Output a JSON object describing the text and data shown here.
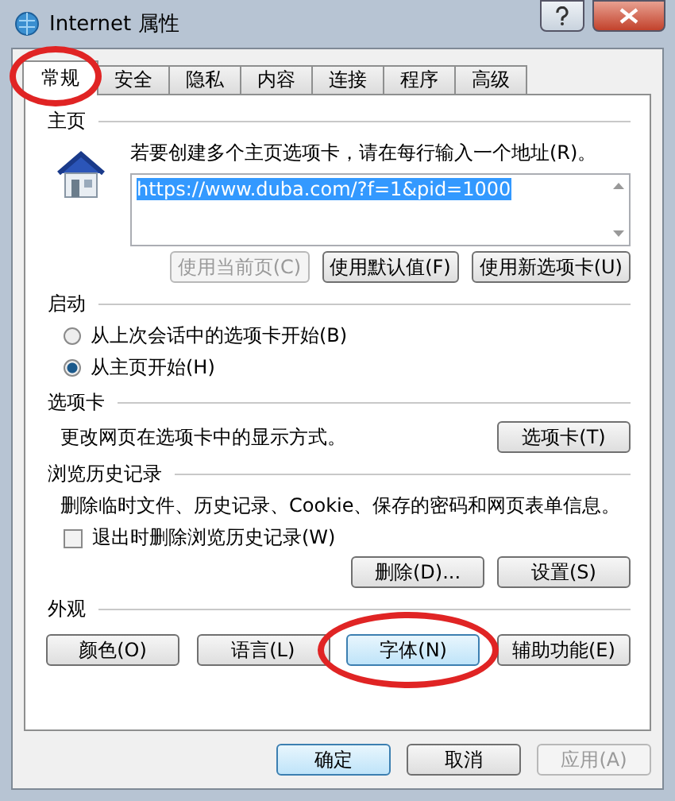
{
  "window": {
    "title": "Internet 属性"
  },
  "tabs": [
    {
      "label": "常规",
      "selected": true,
      "circled": true
    },
    {
      "label": "安全",
      "selected": false,
      "circled": false
    },
    {
      "label": "隐私",
      "selected": false,
      "circled": false
    },
    {
      "label": "内容",
      "selected": false,
      "circled": false
    },
    {
      "label": "连接",
      "selected": false,
      "circled": false
    },
    {
      "label": "程序",
      "selected": false,
      "circled": false
    },
    {
      "label": "高级",
      "selected": false,
      "circled": false
    }
  ],
  "home": {
    "heading": "主页",
    "instruction": "若要创建多个主页选项卡，请在每行输入一个地址(R)。",
    "value": "https://www.duba.com/?f=1&pid=1000",
    "buttons": [
      {
        "label": "使用当前页(C)",
        "disabled": true
      },
      {
        "label": "使用默认值(F)",
        "disabled": false
      },
      {
        "label": "使用新选项卡(U)",
        "disabled": false
      }
    ]
  },
  "startup": {
    "heading": "启动",
    "options": [
      {
        "label": "从上次会话中的选项卡开始(B)",
        "selected": false
      },
      {
        "label": "从主页开始(H)",
        "selected": true
      }
    ]
  },
  "tabs_section": {
    "heading": "选项卡",
    "description": "更改网页在选项卡中的显示方式。",
    "button": "选项卡(T)"
  },
  "history": {
    "heading": "浏览历史记录",
    "description": "删除临时文件、历史记录、Cookie、保存的密码和网页表单信息。",
    "checkbox": {
      "label": "退出时删除浏览历史记录(W)",
      "checked": false
    },
    "buttons": [
      "删除(D)...",
      "设置(S)"
    ]
  },
  "appearance": {
    "heading": "外观",
    "buttons": [
      {
        "label": "颜色(O)",
        "highlighted": false,
        "circled": false
      },
      {
        "label": "语言(L)",
        "highlighted": false,
        "circled": false
      },
      {
        "label": "字体(N)",
        "highlighted": true,
        "circled": true
      },
      {
        "label": "辅助功能(E)",
        "highlighted": false,
        "circled": false
      }
    ]
  },
  "footer": {
    "buttons": [
      {
        "label": "确定",
        "highlighted": true,
        "disabled": false
      },
      {
        "label": "取消",
        "highlighted": false,
        "disabled": false
      },
      {
        "label": "应用(A)",
        "highlighted": false,
        "disabled": true
      }
    ]
  }
}
